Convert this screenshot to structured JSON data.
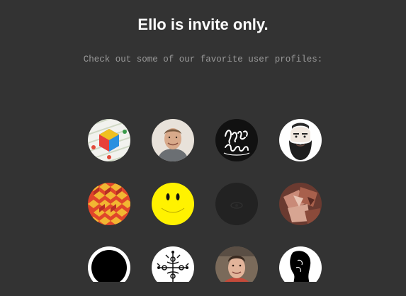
{
  "heading": {
    "title": "Ello is invite only.",
    "subtitle": "Check out some of our favorite user profiles:"
  },
  "profiles": [
    {
      "icon": "colorful-cube-avatar"
    },
    {
      "icon": "smiling-man-avatar"
    },
    {
      "icon": "lettering-logo-avatar"
    },
    {
      "icon": "bearded-man-avatar"
    },
    {
      "icon": "geometric-pattern-avatar"
    },
    {
      "icon": "yellow-smiley-avatar"
    },
    {
      "icon": "dark-eye-avatar"
    },
    {
      "icon": "abstract-collage-avatar"
    },
    {
      "icon": "black-circle-avatar"
    },
    {
      "icon": "ornament-drawing-avatar"
    },
    {
      "icon": "young-man-avatar"
    },
    {
      "icon": "silhouette-portrait-avatar"
    }
  ],
  "colors": {
    "background": "#333333",
    "title": "#ffffff",
    "subtitle": "#9a9a9a"
  }
}
